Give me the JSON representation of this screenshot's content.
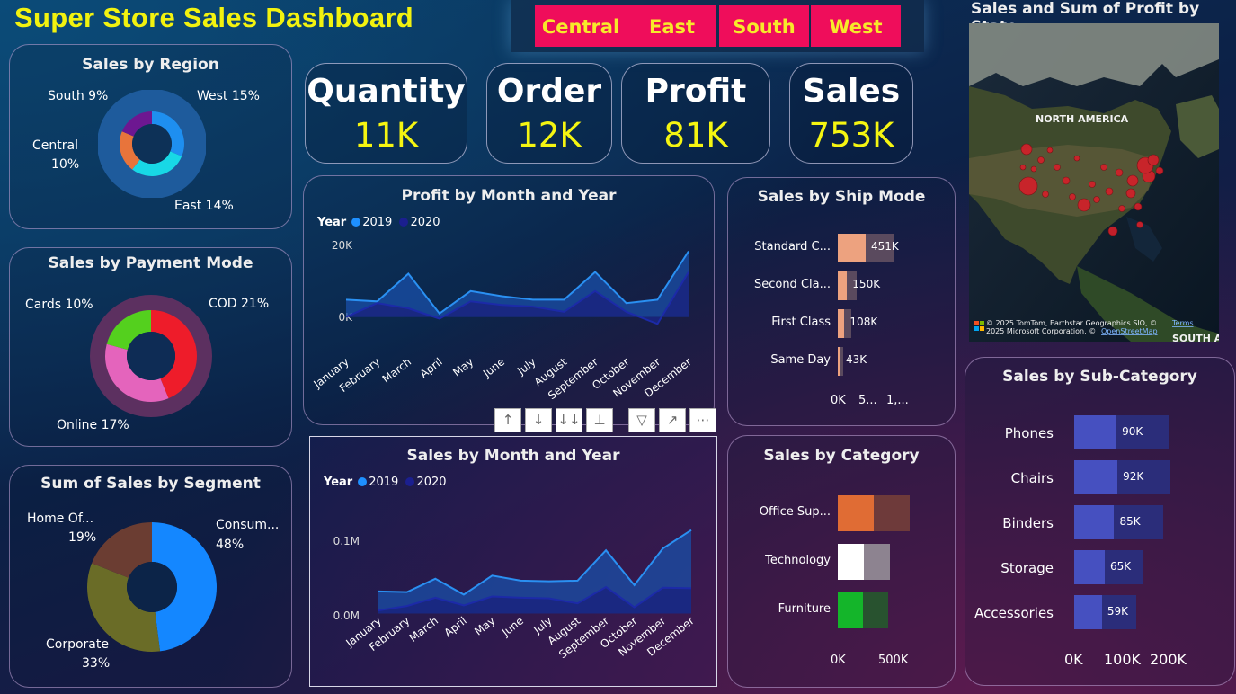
{
  "title": "Super Store Sales Dashboard",
  "slicers": [
    "Central",
    "East",
    "South",
    "West"
  ],
  "kpis": [
    {
      "label": "Quantity",
      "value": "11K"
    },
    {
      "label": "Order",
      "value": "12K"
    },
    {
      "label": "Profit",
      "value": "81K"
    },
    {
      "label": "Sales",
      "value": "753K"
    }
  ],
  "region": {
    "title": "Sales by Region",
    "labels": {
      "south": "South 9%",
      "west": "West 15%",
      "central_line1": "Central",
      "central_line2": "10%",
      "east": "East 14%"
    }
  },
  "payment": {
    "title": "Sales by Payment Mode",
    "labels": {
      "cards": "Cards 10%",
      "cod": "COD 21%",
      "online": "Online 17%"
    }
  },
  "segment": {
    "title": "Sum of Sales by Segment",
    "labels": {
      "home_line1": "Home Of...",
      "home_line2": "19%",
      "consumer_line1": "Consum...",
      "consumer_line2": "48%",
      "corporate_line1": "Corporate",
      "corporate_line2": "33%"
    }
  },
  "legend": {
    "year_label": "Year",
    "y2019": "2019",
    "y2020": "2020"
  },
  "months": [
    "January",
    "February",
    "March",
    "April",
    "May",
    "June",
    "July",
    "August",
    "September",
    "October",
    "November",
    "December"
  ],
  "profit_chart": {
    "title": "Profit by Month and Year",
    "y_ticks": [
      "20K",
      "0K"
    ]
  },
  "sales_chart": {
    "title": "Sales by Month and Year",
    "y_ticks": [
      "0.1M",
      "0.0M"
    ]
  },
  "ship": {
    "title": "Sales by Ship Mode",
    "rows": [
      {
        "label": "Standard C...",
        "value": "451K"
      },
      {
        "label": "Second Cla...",
        "value": "150K"
      },
      {
        "label": "First Class",
        "value": "108K"
      },
      {
        "label": "Same Day",
        "value": "43K"
      }
    ],
    "x_ticks": [
      "0K",
      "5...",
      "1,..."
    ]
  },
  "category": {
    "title": "Sales by Category",
    "rows": [
      {
        "label": "Office Sup..."
      },
      {
        "label": "Technology"
      },
      {
        "label": "Furniture"
      }
    ],
    "x_ticks": [
      "0K",
      "500K"
    ]
  },
  "subcat": {
    "title": "Sales by Sub-Category",
    "rows": [
      {
        "label": "Phones",
        "value": "90K"
      },
      {
        "label": "Chairs",
        "value": "92K"
      },
      {
        "label": "Binders",
        "value": "85K"
      },
      {
        "label": "Storage",
        "value": "65K"
      },
      {
        "label": "Accessories",
        "value": "59K"
      }
    ],
    "x_ticks": [
      "0K",
      "100K",
      "200K"
    ]
  },
  "map": {
    "title": "Sales and Sum of Profit by State",
    "continent": "NORTH AMERICA",
    "continent_south": "SOUTH A",
    "attribution_line1": "© 2025 TomTom, Earthstar Geographics SIO, ©",
    "terms": "Terms",
    "attribution_line2": "2025 Microsoft Corporation, ©",
    "osm": "OpenStreetMap"
  },
  "toolbar": {
    "icons": [
      "drill-up-icon",
      "drill-down-icon",
      "expand-next-level-icon",
      "expand-hierarchy-icon",
      "filter-icon",
      "focus-mode-icon",
      "more-options-icon"
    ]
  },
  "colors": {
    "title": "#f2f20f",
    "slicer_bg": "#ef0d5b",
    "slicer_text": "#f7ea2a",
    "kpi_value": "#f5f511",
    "series_2019": "#1e90ff",
    "series_2020": "#1b1f8f"
  },
  "chart_data": [
    {
      "type": "line",
      "title": "Profit by Month and Year",
      "x": [
        "January",
        "February",
        "March",
        "April",
        "May",
        "June",
        "July",
        "August",
        "September",
        "October",
        "November",
        "December"
      ],
      "ylim": [
        -4000,
        22000
      ],
      "series": [
        {
          "name": "2019",
          "values": [
            0,
            4000,
            2500,
            -500,
            4500,
            3500,
            3000,
            1500,
            7500,
            1500,
            -2000,
            13000
          ]
        },
        {
          "name": "2020",
          "values": [
            5000,
            4500,
            12500,
            1000,
            7500,
            6000,
            5000,
            5000,
            13000,
            4000,
            5000,
            19000
          ]
        }
      ]
    },
    {
      "type": "line",
      "title": "Sales by Month and Year",
      "x": [
        "January",
        "February",
        "March",
        "April",
        "May",
        "June",
        "July",
        "August",
        "September",
        "October",
        "November",
        "December"
      ],
      "ylim": [
        -5000,
        180000
      ],
      "series": [
        {
          "name": "2019",
          "values": [
            5000,
            12000,
            25000,
            13000,
            27000,
            25000,
            24000,
            16000,
            42000,
            10000,
            41000,
            40000
          ]
        },
        {
          "name": "2020",
          "values": [
            35000,
            34000,
            55000,
            30000,
            60000,
            52000,
            51000,
            52000,
            100000,
            45000,
            103000,
            132000
          ]
        }
      ]
    },
    {
      "type": "pie",
      "title": "Sales by Region",
      "categories": [
        "West",
        "East",
        "Central",
        "South"
      ],
      "values": [
        15,
        14,
        10,
        9
      ]
    },
    {
      "type": "pie",
      "title": "Sales by Payment Mode",
      "categories": [
        "COD",
        "Online",
        "Cards"
      ],
      "values": [
        21,
        17,
        10
      ]
    },
    {
      "type": "pie",
      "title": "Sum of Sales by Segment",
      "categories": [
        "Consumer",
        "Corporate",
        "Home Office"
      ],
      "values": [
        48,
        33,
        19
      ]
    },
    {
      "type": "bar",
      "title": "Sales by Ship Mode",
      "categories": [
        "Standard Class",
        "Second Class",
        "First Class",
        "Same Day"
      ],
      "values": [
        451,
        150,
        108,
        43
      ]
    },
    {
      "type": "bar",
      "title": "Sales by Category",
      "categories": [
        "Office Supplies",
        "Technology",
        "Furniture"
      ],
      "values": [
        725,
        530,
        510
      ]
    },
    {
      "type": "bar",
      "title": "Sales by Sub-Category",
      "categories": [
        "Phones",
        "Chairs",
        "Binders",
        "Storage",
        "Accessories"
      ],
      "values": [
        90,
        92,
        85,
        65,
        59
      ]
    }
  ]
}
